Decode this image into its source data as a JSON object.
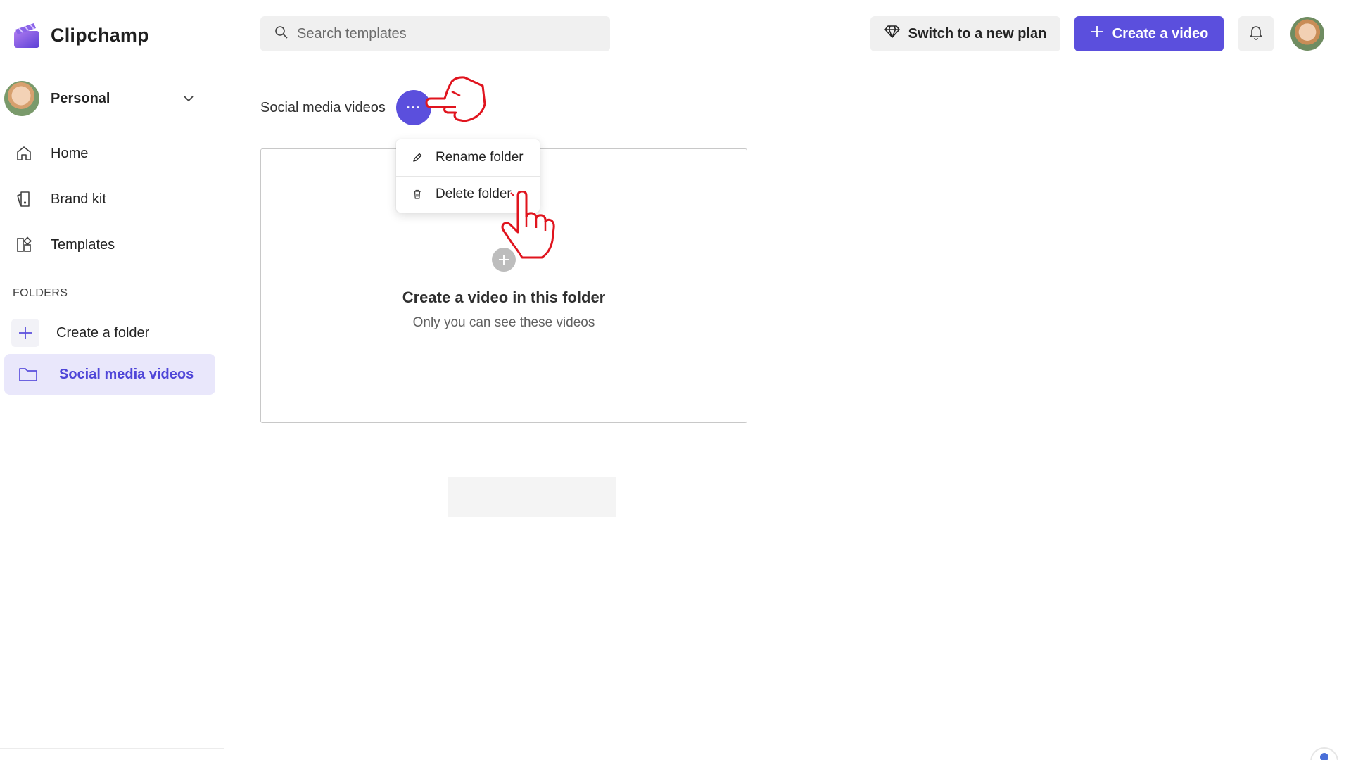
{
  "app": {
    "name": "Clipchamp"
  },
  "account": {
    "name": "Personal"
  },
  "sidebar": {
    "nav": [
      {
        "label": "Home",
        "icon": "home-icon"
      },
      {
        "label": "Brand kit",
        "icon": "brand-kit-icon"
      },
      {
        "label": "Templates",
        "icon": "templates-icon"
      }
    ],
    "folders_heading": "FOLDERS",
    "folders": [
      {
        "label": "Create a folder",
        "icon": "plus-icon"
      },
      {
        "label": "Social media videos",
        "icon": "folder-icon",
        "active": true
      }
    ]
  },
  "header": {
    "search_placeholder": "Search templates",
    "plan_label": "Switch to a new plan",
    "create_label": "Create a video"
  },
  "main": {
    "folder_title": "Social media videos",
    "more_label": "···",
    "empty_title": "Create a video in this folder",
    "empty_subtitle": "Only you can see these videos"
  },
  "context_menu": {
    "items": [
      {
        "label": "Rename folder",
        "icon": "pencil-icon"
      },
      {
        "label": "Delete folder",
        "icon": "trash-icon"
      }
    ]
  },
  "colors": {
    "accent": "#5b4fdd",
    "active_bg": "#e9e7fb",
    "annotation": "#e0141e"
  }
}
